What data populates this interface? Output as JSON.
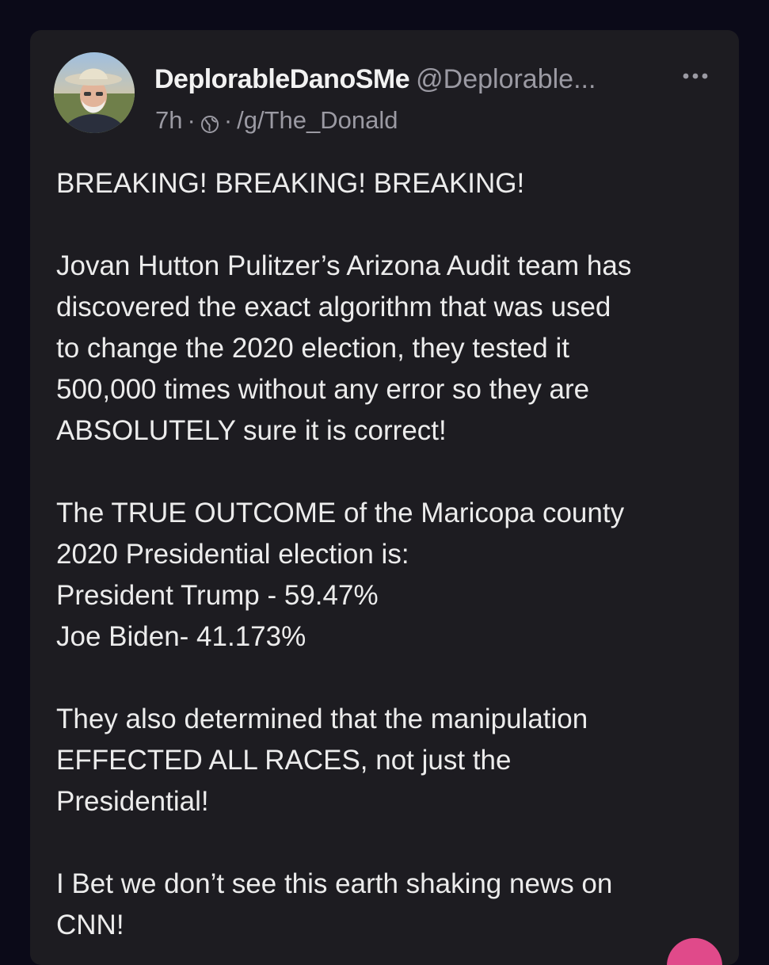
{
  "post": {
    "author": {
      "display_name": "DeplorableDanoSMe",
      "handle": "@Deplorable..."
    },
    "more_icon": "more-horizontal-icon",
    "meta": {
      "time": "7h",
      "separator": "·",
      "visibility_icon": "globe-icon",
      "community": "/g/The_Donald"
    },
    "body": {
      "paragraphs": [
        [
          "BREAKING! BREAKING! BREAKING!"
        ],
        [
          "Jovan Hutton Pulitzer’s Arizona Audit team has",
          "discovered the exact algorithm that was used",
          "to change the 2020 election, they tested it",
          "500,000 times without any error so they are",
          "ABSOLUTELY sure it is correct!"
        ],
        [
          "The TRUE OUTCOME of the Maricopa county",
          "2020 Presidential election is:",
          "President Trump - 59.47%",
          "Joe Biden- 41.173%"
        ],
        [
          "They also determined that the manipulation",
          "EFFECTED ALL RACES, not just the",
          "Presidential!"
        ],
        [
          "I Bet we don’t see this earth shaking news on",
          "CNN!"
        ]
      ]
    }
  },
  "colors": {
    "background": "#0b0a18",
    "card": "#1d1c21",
    "text": "#ececec",
    "muted": "#9b9aa3",
    "accent": "#e04a8a"
  }
}
